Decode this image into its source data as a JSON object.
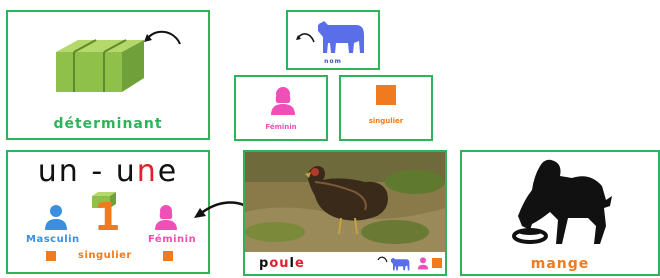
{
  "cards": {
    "determinant": {
      "label": "déterminant"
    },
    "nom": {
      "label": "nom"
    },
    "feminin": {
      "label": "Féminin"
    },
    "singulier": {
      "label": "singulier"
    },
    "article": {
      "word_part1": "un - u",
      "word_part2": "n",
      "word_part3": "e",
      "masculin_label": "Masculin",
      "feminin_label": "Féminin",
      "number": "1",
      "singulier_label": "singulier"
    },
    "poule": {
      "part1": "p",
      "part2": "ou",
      "part3": "l",
      "part4": "e"
    },
    "mange": {
      "label": "mange"
    }
  },
  "colors": {
    "green": "#2fb35a",
    "orange": "#f07a1e",
    "pink": "#f04fb8",
    "blue": "#3a8fe0",
    "cow_blue": "#5a6ee8",
    "red": "#e0202a"
  }
}
